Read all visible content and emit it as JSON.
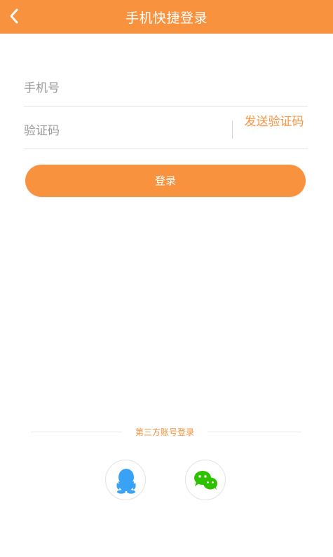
{
  "header": {
    "title": "手机快捷登录",
    "back_icon": "chevron-left-icon",
    "background": "#F8923E"
  },
  "form": {
    "phone": {
      "value": "",
      "placeholder": "手机号"
    },
    "code": {
      "value": "",
      "placeholder": "验证码"
    },
    "send_code_label": "发送验证码",
    "submit_label": "登录"
  },
  "third_party": {
    "label": "第三方账号登录",
    "providers": [
      {
        "id": "qq",
        "icon": "qq-icon",
        "color": "#3AA2F5"
      },
      {
        "id": "wechat",
        "icon": "wechat-icon",
        "color": "#2DC100"
      }
    ]
  },
  "colors": {
    "accent": "#F8923E",
    "divider": "#e2e2e2",
    "placeholder": "#9a9a9a"
  }
}
